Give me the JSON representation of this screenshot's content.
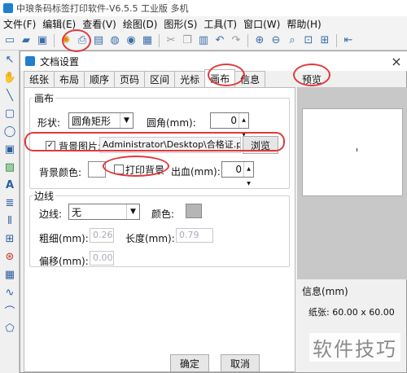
{
  "app": {
    "title": "中琅条码标签打印软件-V6.5.5 工业版 多机",
    "menu": [
      "文件(F)",
      "编辑(E)",
      "查看(V)",
      "绘图(D)",
      "图形(S)",
      "工具(T)",
      "窗口(W)",
      "帮助(H)"
    ]
  },
  "dialog": {
    "title": "文档设置",
    "close": "×",
    "tabs": [
      "纸张",
      "布局",
      "顺序",
      "页码",
      "区间",
      "光标",
      "画布",
      "信息"
    ],
    "active_tab": "画布",
    "canvas": {
      "group_title": "画布",
      "shape_label": "形状:",
      "shape_value": "圆角矩形",
      "radius_label": "圆角(mm):",
      "radius_value": "0",
      "bg_image_label": "背景图片:",
      "bg_image_checked": true,
      "bg_image_path": "Administrator\\Desktop\\合格证.png",
      "browse_label": "浏览",
      "bg_color_label": "背景颜色:",
      "print_bg_label": "打印背景",
      "bleed_label": "出血(mm):",
      "bleed_value": "0"
    },
    "border": {
      "group_title": "边线",
      "line_label": "边线:",
      "line_value": "无",
      "color_label": "颜色:",
      "width_label": "粗细(mm):",
      "width_value": "0.26",
      "length_label": "长度(mm):",
      "length_value": "0.79",
      "offset_label": "偏移(mm):",
      "offset_value": "0.00"
    },
    "ok_label": "确定",
    "cancel_label": "取消",
    "preview_title": "预览",
    "info_title": "信息(mm)",
    "paper_label": "纸张: 60.00 x 60.00"
  },
  "watermark": "软件技巧",
  "colors": {
    "accent": "#1f7fd1",
    "highlight": "#e0393e",
    "swatch_gray": "#b5b5b5"
  }
}
